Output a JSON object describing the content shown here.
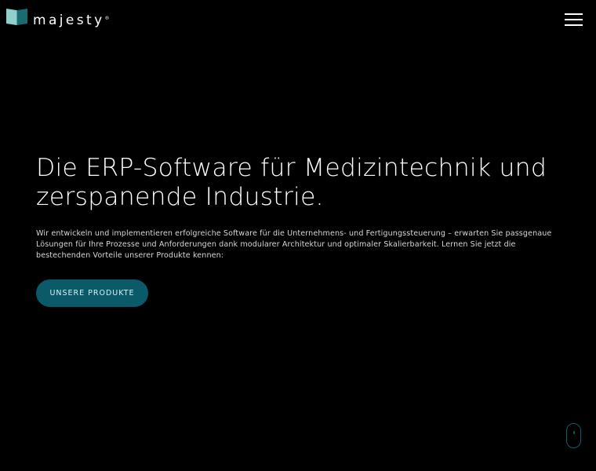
{
  "brand": {
    "name": "majesty",
    "registered": "®",
    "logo_icon": "book-mark-icon",
    "colors": {
      "mark_light": "#7fc7c5",
      "mark_dark": "#1f6f74",
      "accent": "#0b5a69"
    }
  },
  "header": {
    "menu_icon": "hamburger-menu-icon"
  },
  "hero": {
    "title": "Die ERP-Software für Medizintechnik und zerspanende Industrie.",
    "description": "Wir entwickeln und implementieren erfolgreiche Software für die Unternehmens- und Fertigungssteuerung – erwarten Sie passgenaue Lösungen für Ihre Prozesse und Anforderungen dank modularer Architektur und optimaler Skalierbarkeit. Lernen Sie jetzt die bestechenden Vorteile unserer Produkte kennen:",
    "cta_label": "Unsere Produkte"
  },
  "scroll_indicator": {
    "icon": "scroll-mouse-icon"
  }
}
